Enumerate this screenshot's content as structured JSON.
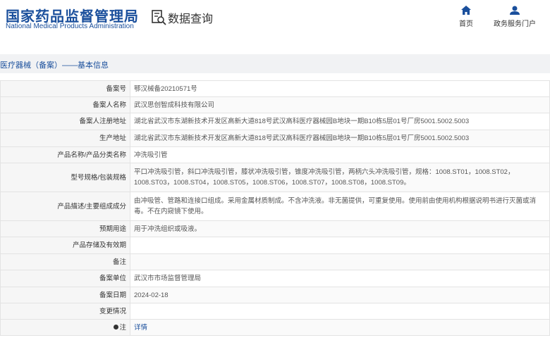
{
  "header": {
    "org_cn": "国家药品监督管理局",
    "org_en": "National Medical Products Administration",
    "search_title": "数据查询",
    "nav": {
      "home": "首页",
      "gov_portal": "政务服务门户"
    }
  },
  "breadcrumb": "医疗器械（备案）——基本信息",
  "fields": {
    "record_no": {
      "label": "备案号",
      "value": "鄂汉械备20210571号"
    },
    "filer": {
      "label": "备案人名称",
      "value": "武汉思创智成科技有限公司"
    },
    "reg_address": {
      "label": "备案人注册地址",
      "value": "湖北省武汉市东湖新技术开发区高新大道818号武汉高科医疗器械园B地块一期B10栋5层01号厂房5001.5002.5003"
    },
    "prod_address": {
      "label": "生产地址",
      "value": "湖北省武汉市东湖新技术开发区高新大道818号武汉高科医疗器械园B地块一期B10栋5层01号厂房5001.5002.5003"
    },
    "product_name": {
      "label": "产品名称/产品分类名称",
      "value": "冲洗吸引管"
    },
    "model_spec": {
      "label": "型号规格/包装规格",
      "value": "平口冲洗吸引管，斜口冲洗吸引管，膝状冲洗吸引管，锥度冲洗吸引管，两柄六头冲洗吸引管，规格：1008.ST01，1008.ST02，1008.ST03，1008.ST04，1008.ST05，1008.ST06，1008.ST07，1008.ST08，1008.ST09。"
    },
    "description": {
      "label": "产品描述/主要组成成分",
      "value": "由冲吸管、管路和连接口组成。采用金属材质制成。不含冲洗液。非无菌提供，可重复使用。使用前由使用机构根据说明书进行灭菌或消毒。不在内窥镜下使用。"
    },
    "intended_use": {
      "label": "预期用途",
      "value": "用于冲洗组织或吸液。"
    },
    "storage": {
      "label": "产品存储及有效期",
      "value": ""
    },
    "remark": {
      "label": "备注",
      "value": ""
    },
    "record_unit": {
      "label": "备案单位",
      "value": "武汉市市场监督管理局"
    },
    "record_date": {
      "label": "备案日期",
      "value": "2024-02-18"
    },
    "change": {
      "label": "变更情况",
      "value": ""
    },
    "note": {
      "label": "注",
      "value": "详情"
    }
  },
  "colors": {
    "brand_blue": "#1a4f9c",
    "band_gray": "#f1f2f4",
    "label_bg": "#f6f6f6"
  },
  "icons": [
    "search-doc-icon",
    "home-icon",
    "user-icon",
    "bullet-icon"
  ]
}
